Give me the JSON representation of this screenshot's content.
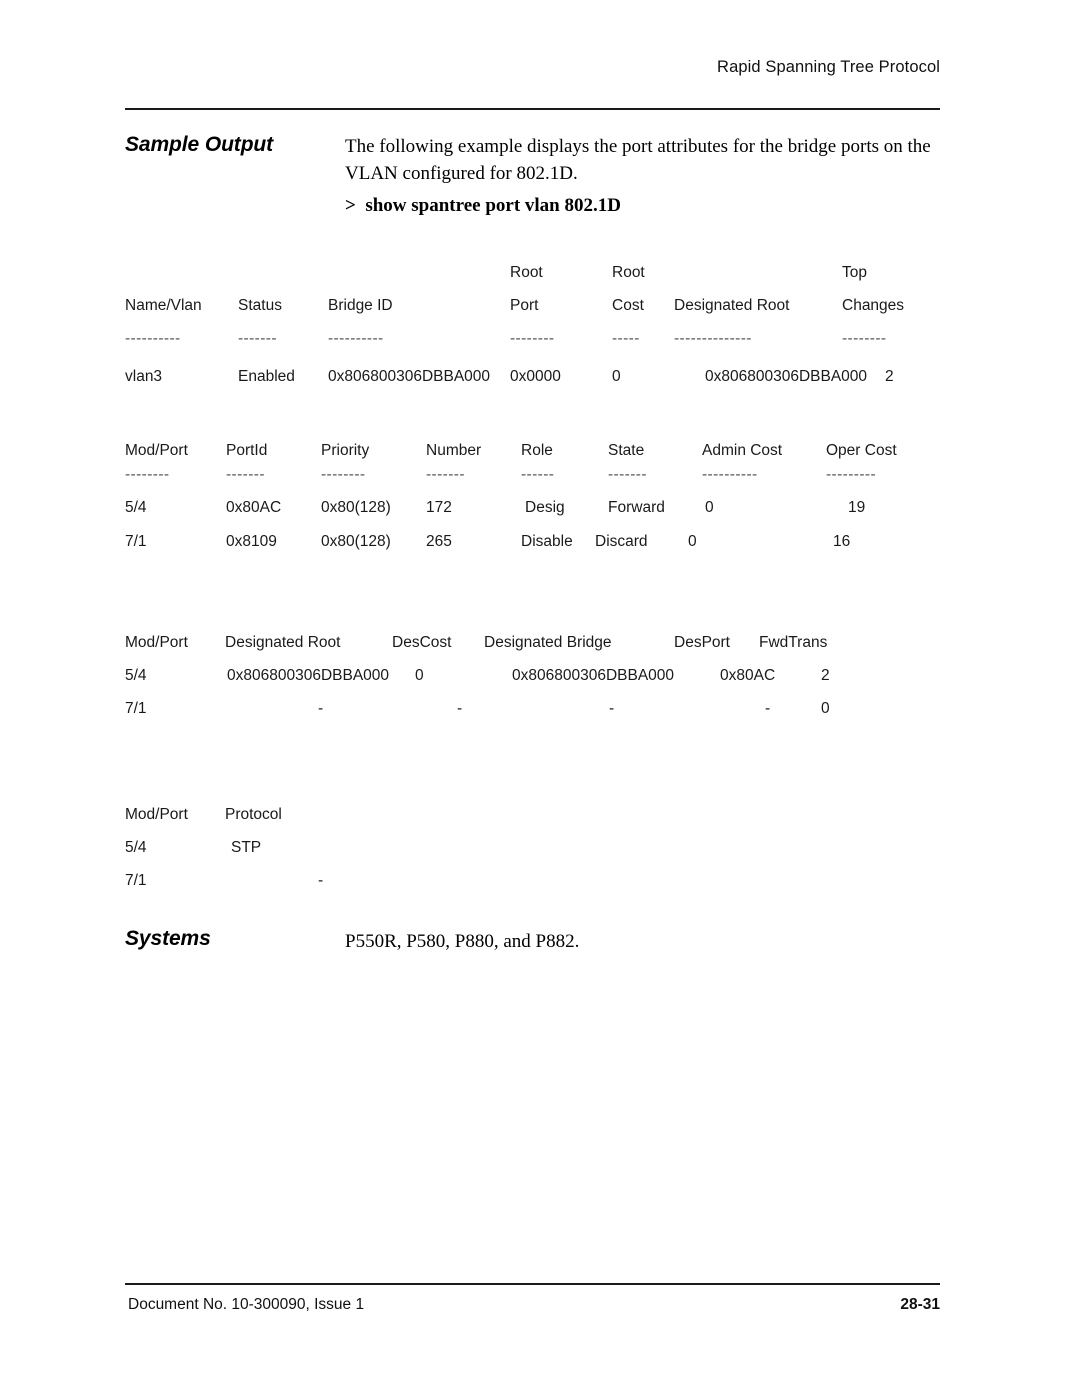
{
  "header": {
    "running_head": "Rapid Spanning Tree Protocol"
  },
  "sections": {
    "sample_output": {
      "heading": "Sample Output",
      "paragraph": "The following example displays the port attributes for the bridge ports on the VLAN configured for 802.1D.",
      "command": ">  show spantree port vlan 802.1D"
    },
    "systems": {
      "heading": "Systems",
      "text": "P550R, P580, P880, and P882."
    }
  },
  "cli_output": {
    "vlan_table": {
      "headers_line1": [
        "",
        "",
        "",
        "Root",
        "Root",
        "",
        "Top"
      ],
      "headers_line2": [
        "Name/Vlan",
        "Status",
        "Bridge ID",
        "Port",
        "Cost",
        "Designated Root",
        "Changes"
      ],
      "separators": [
        "----------",
        "-------",
        "----------",
        "--------",
        "-----",
        "--------------",
        "--------"
      ],
      "rows": [
        {
          "name_vlan": "vlan3",
          "status": "Enabled",
          "bridge_id": "0x806800306DBBA000",
          "root_port": "0x0000",
          "root_cost": "0",
          "designated_root": "0x806800306DBBA000",
          "top_changes": "2"
        }
      ]
    },
    "port_table": {
      "headers": [
        "Mod/Port",
        "PortId",
        "Priority",
        "Number",
        "Role",
        "State",
        "Admin Cost",
        "Oper Cost"
      ],
      "separators": [
        "--------",
        "-------",
        "--------",
        "-------",
        "------",
        "-------",
        "----------",
        "---------"
      ],
      "rows": [
        {
          "mod_port": "5/4",
          "port_id": "0x80AC",
          "priority": "0x80(128)",
          "number": "172",
          "role": "Desig",
          "state": "Forward",
          "admin_cost": "0",
          "oper_cost": "19"
        },
        {
          "mod_port": "7/1",
          "port_id": "0x8109",
          "priority": "0x80(128)",
          "number": "265",
          "role": "Disable",
          "state": "Discard",
          "admin_cost": "0",
          "oper_cost": "16"
        }
      ]
    },
    "designated_table": {
      "headers": [
        "Mod/Port",
        "Designated Root",
        "DesCost",
        "Designated Bridge",
        "DesPort",
        "FwdTrans"
      ],
      "rows": [
        {
          "mod_port": "5/4",
          "designated_root": "0x806800306DBBA000",
          "des_cost": "0",
          "designated_bridge": "0x806800306DBBA000",
          "des_port": "0x80AC",
          "fwd_trans": "2"
        },
        {
          "mod_port": "7/1",
          "designated_root": "-",
          "des_cost": "-",
          "designated_bridge": "-",
          "des_port": "-",
          "fwd_trans": "0"
        }
      ]
    },
    "protocol_table": {
      "headers": [
        "Mod/Port",
        "Protocol"
      ],
      "rows": [
        {
          "mod_port": "5/4",
          "protocol": "STP"
        },
        {
          "mod_port": "7/1",
          "protocol": "-"
        }
      ]
    }
  },
  "footer": {
    "document_no": "Document No. 10-300090, Issue 1",
    "page_no": "28-31"
  }
}
